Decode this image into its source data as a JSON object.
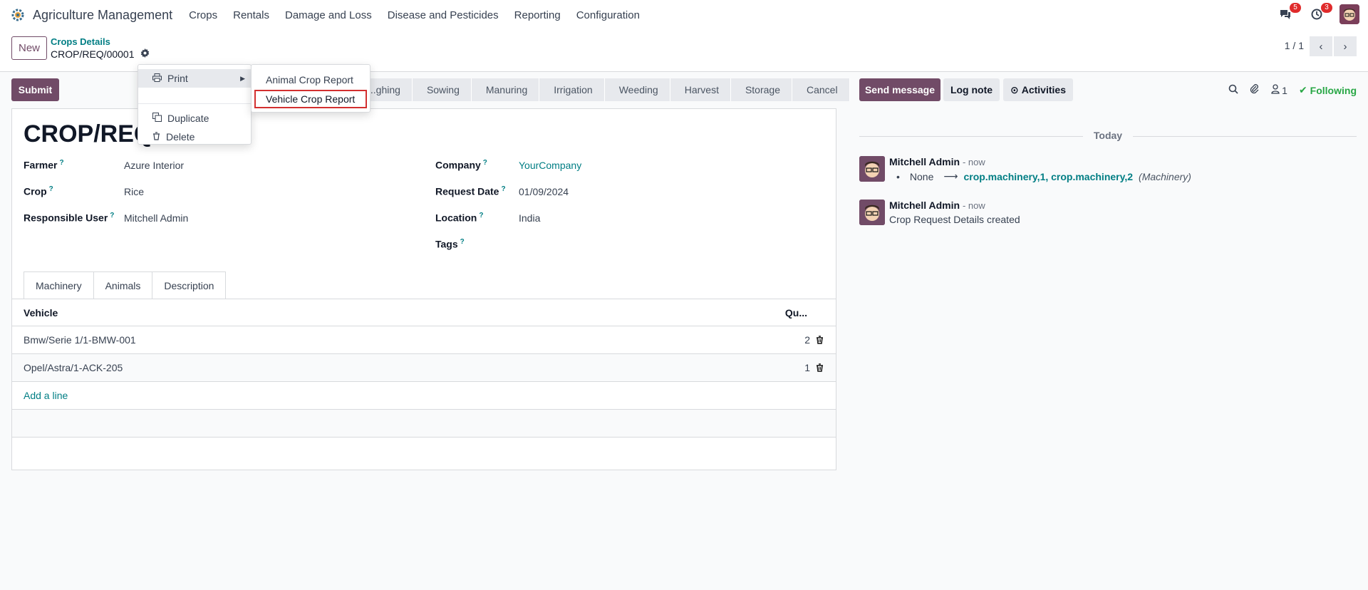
{
  "topbar": {
    "app_name": "Agriculture Management",
    "menu": [
      "Crops",
      "Rentals",
      "Damage and Loss",
      "Disease and Pesticides",
      "Reporting",
      "Configuration"
    ],
    "messages_badge": "5",
    "activities_badge": "3"
  },
  "control": {
    "new_label": "New",
    "breadcrumb_parent": "Crops Details",
    "record_ref": "CROP/REQ/00001",
    "pager": "1 / 1"
  },
  "form": {
    "submit_label": "Submit",
    "stages": [
      "...ghing",
      "Sowing",
      "Manuring",
      "Irrigation",
      "Weeding",
      "Harvest",
      "Storage",
      "Cancel"
    ],
    "title": "CROP/REQ",
    "fields": {
      "farmer_label": "Farmer",
      "farmer_value": "Azure Interior",
      "crop_label": "Crop",
      "crop_value": "Rice",
      "responsible_label": "Responsible User",
      "responsible_value": "Mitchell Admin",
      "company_label": "Company",
      "company_value": "YourCompany",
      "request_date_label": "Request Date",
      "request_date_value": "01/09/2024",
      "location_label": "Location",
      "location_value": "India",
      "tags_label": "Tags",
      "help_mark": "?"
    },
    "tabs": [
      "Machinery",
      "Animals",
      "Description"
    ],
    "table": {
      "col_vehicle": "Vehicle",
      "col_qty": "Qu...",
      "rows": [
        {
          "vehicle": "Bmw/Serie 1/1-BMW-001",
          "qty": "2"
        },
        {
          "vehicle": "Opel/Astra/1-ACK-205",
          "qty": "1"
        }
      ],
      "add_line": "Add a line"
    }
  },
  "gear_menu": {
    "print": "Print",
    "duplicate": "Duplicate",
    "delete": "Delete",
    "submenu": [
      "Animal Crop Report",
      "Vehicle Crop Report"
    ]
  },
  "chatter": {
    "send_message": "Send message",
    "log_note": "Log note",
    "activities": "Activities",
    "followers_count": "1",
    "following": "Following",
    "today": "Today",
    "messages": [
      {
        "author": "Mitchell Admin",
        "when": "- now",
        "old": "None",
        "new": "crop.machinery,1, crop.machinery,2",
        "field": "(Machinery)"
      },
      {
        "author": "Mitchell Admin",
        "when": "- now",
        "body": "Crop Request Details created"
      }
    ]
  },
  "colors": {
    "primary": "#714b67",
    "link": "#017e84",
    "following": "#28a745",
    "highlight_border": "#d32f2f"
  }
}
